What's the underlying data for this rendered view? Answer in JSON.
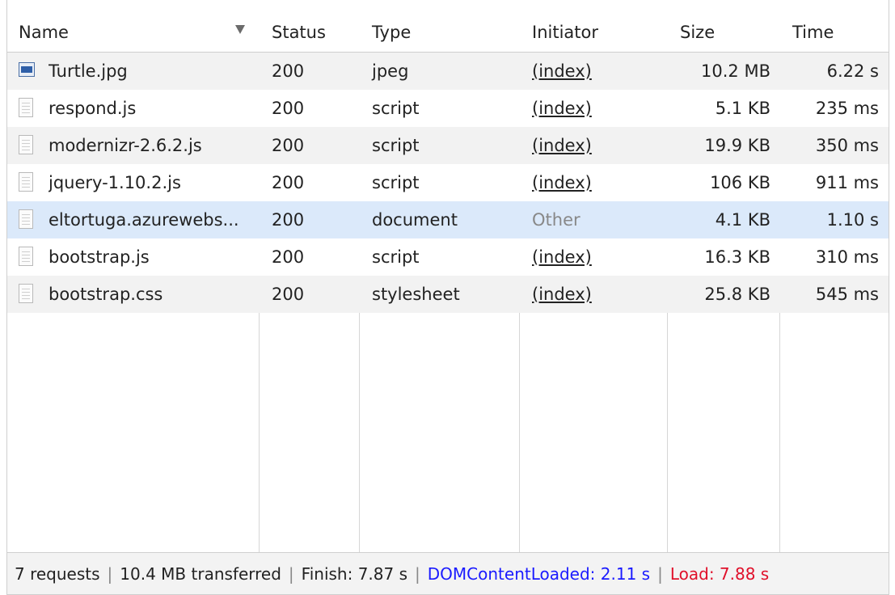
{
  "columns": {
    "name": "Name",
    "status": "Status",
    "type": "Type",
    "initiator": "Initiator",
    "size": "Size",
    "time": "Time"
  },
  "rows": [
    {
      "name": "Turtle.jpg",
      "status": "200",
      "type": "jpeg",
      "initiator": "(index)",
      "size": "10.2 MB",
      "time": "6.22 s",
      "icon": "image-file-icon"
    },
    {
      "name": "respond.js",
      "status": "200",
      "type": "script",
      "initiator": "(index)",
      "size": "5.1 KB",
      "time": "235 ms",
      "icon": "document-file-icon"
    },
    {
      "name": "modernizr-2.6.2.js",
      "status": "200",
      "type": "script",
      "initiator": "(index)",
      "size": "19.9 KB",
      "time": "350 ms",
      "icon": "document-file-icon"
    },
    {
      "name": "jquery-1.10.2.js",
      "status": "200",
      "type": "script",
      "initiator": "(index)",
      "size": "106 KB",
      "time": "911 ms",
      "icon": "document-file-icon"
    },
    {
      "name": "eltortuga.azurewebs...",
      "status": "200",
      "type": "document",
      "initiator": "Other",
      "size": "4.1 KB",
      "time": "1.10 s",
      "icon": "document-file-icon"
    },
    {
      "name": "bootstrap.js",
      "status": "200",
      "type": "script",
      "initiator": "(index)",
      "size": "16.3 KB",
      "time": "310 ms",
      "icon": "document-file-icon"
    },
    {
      "name": "bootstrap.css",
      "status": "200",
      "type": "stylesheet",
      "initiator": "(index)",
      "size": "25.8 KB",
      "time": "545 ms",
      "icon": "document-file-icon"
    }
  ],
  "footer": {
    "requests": "7 requests",
    "transferred": "10.4 MB transferred",
    "finish": "Finish: 7.87 s",
    "dom_content_loaded": "DOMContentLoaded: 2.11 s",
    "load": "Load: 7.88 s",
    "separator": "|"
  },
  "colors": {
    "dom_content_loaded": "#1a1aff",
    "load": "#e0102a",
    "selected_row": "#dbe9fa"
  }
}
